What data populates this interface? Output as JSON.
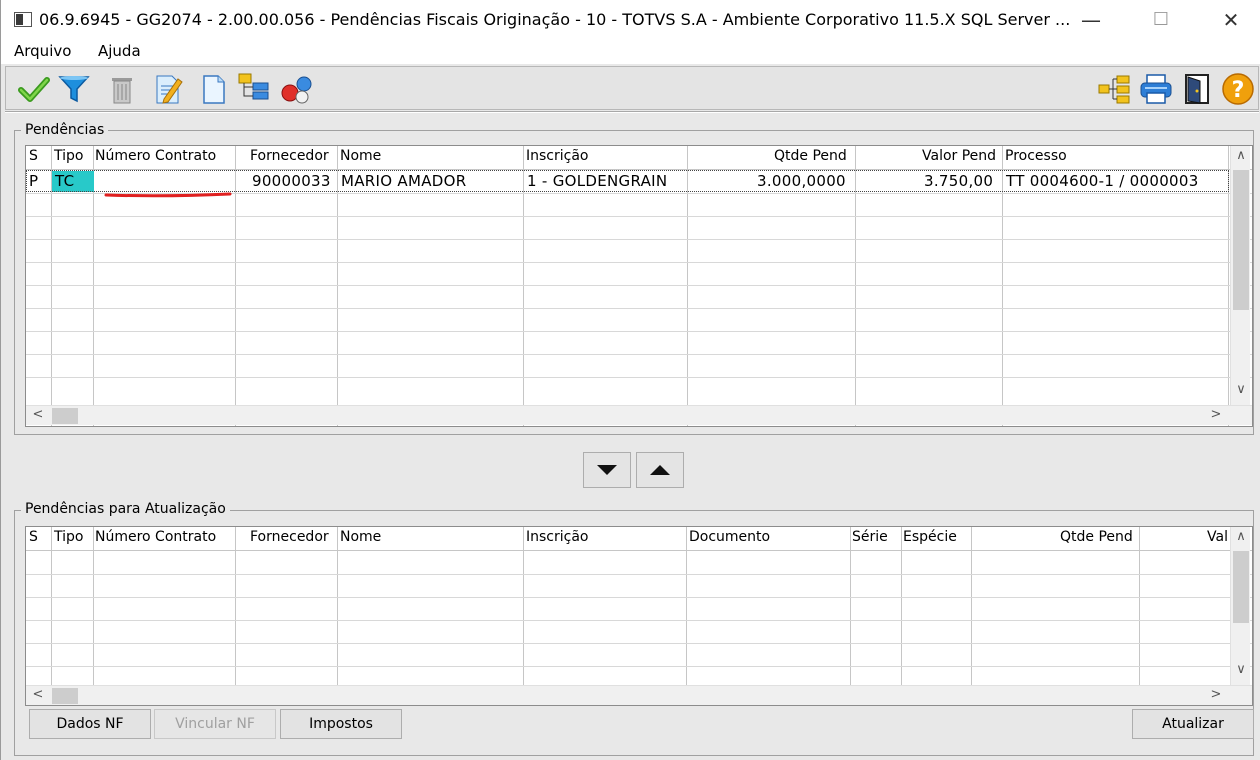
{
  "window": {
    "title": "06.9.6945 - GG2074 - 2.00.00.056 - Pendências Fiscais Originação - 10 - TOTVS S.A - Ambiente Corporativo 11.5.X SQL Server ...",
    "minimize_glyph": "—",
    "maximize_glyph": "☐",
    "close_glyph": "✕"
  },
  "menu": {
    "items": [
      "Arquivo",
      "Ajuda"
    ]
  },
  "toolbar": {
    "left_icons": [
      "checkmark-icon",
      "filter-icon",
      "trash-icon",
      "edit-document-icon",
      "blank-document-icon",
      "tree-structure-icon",
      "circles-icon"
    ],
    "right_icons": [
      "hierarchy-icon",
      "printer-icon",
      "exit-door-icon",
      "help-icon"
    ]
  },
  "pendencias": {
    "legend": "Pendências",
    "columns": [
      "S",
      "Tipo",
      "Número Contrato",
      "Fornecedor",
      "Nome",
      "Inscrição",
      "Qtde Pend",
      "Valor Pend",
      "Processo"
    ],
    "rows": [
      {
        "s": "P",
        "tipo": "TC",
        "numero_contrato": "",
        "fornecedor": "90000033",
        "nome": "MARIO AMADOR",
        "inscricao": "1 - GOLDENGRAIN",
        "qtde_pend": "3.000,0000",
        "valor_pend": "3.750,00",
        "processo": "TT 0004600-1 / 0000003"
      }
    ],
    "tipo_highlight_color": "#28c9c9"
  },
  "move_buttons": {
    "down": "▼",
    "up": "▲"
  },
  "atualizacao": {
    "legend": "Pendências para Atualização",
    "columns": [
      "S",
      "Tipo",
      "Número Contrato",
      "Fornecedor",
      "Nome",
      "Inscrição",
      "Documento",
      "Série",
      "Espécie",
      "Qtde Pend",
      "Val"
    ]
  },
  "buttons": {
    "dados_nf": "Dados NF",
    "vincular_nf": "Vincular NF",
    "impostos": "Impostos",
    "atualizar": "Atualizar"
  },
  "scroll": {
    "up": "∧",
    "down": "∨",
    "left": "<",
    "right": ">"
  },
  "accent": {
    "annotation_red": "#e02020"
  }
}
